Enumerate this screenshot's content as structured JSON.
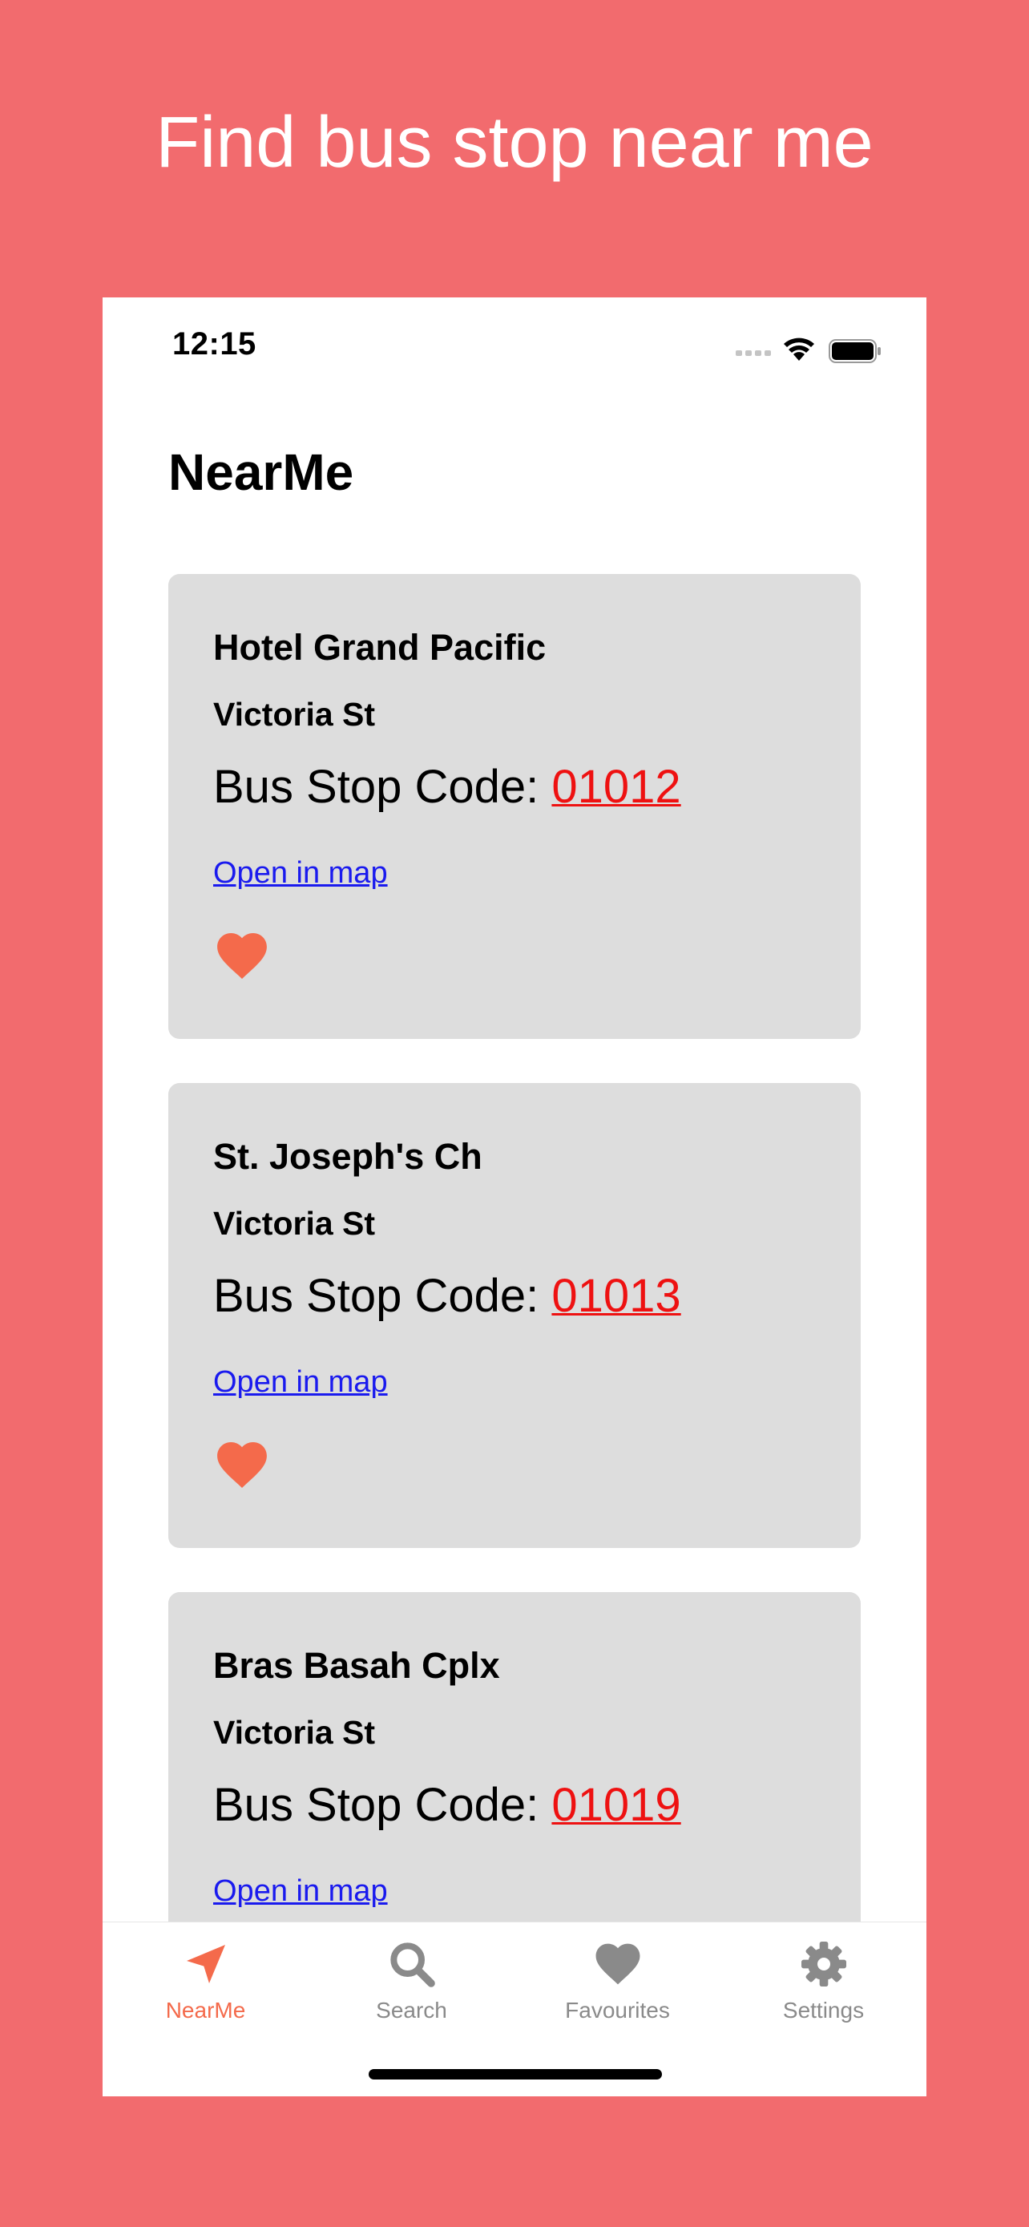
{
  "headline": "Find bus stop near me",
  "status_bar": {
    "time": "12:15"
  },
  "page_title": "NearMe",
  "colors": {
    "background": "#f26b6e",
    "accent": "#f46a4b",
    "code": "#ee1111",
    "link": "#1a1aee",
    "card": "#dddddd"
  },
  "bus_stops": [
    {
      "name": "Hotel Grand Pacific",
      "road": "Victoria St",
      "code_label": "Bus Stop Code:",
      "code": "01012",
      "map_link": "Open in map",
      "favourite": true
    },
    {
      "name": "St. Joseph's Ch",
      "road": "Victoria St",
      "code_label": "Bus Stop Code:",
      "code": "01013",
      "map_link": "Open in map",
      "favourite": true
    },
    {
      "name": "Bras Basah Cplx",
      "road": "Victoria St",
      "code_label": "Bus Stop Code:",
      "code": "01019",
      "map_link": "Open in map",
      "favourite": true
    }
  ],
  "tabs": [
    {
      "label": "NearMe",
      "icon": "location-arrow-icon",
      "active": true
    },
    {
      "label": "Search",
      "icon": "search-icon",
      "active": false
    },
    {
      "label": "Favourites",
      "icon": "heart-icon",
      "active": false
    },
    {
      "label": "Settings",
      "icon": "gear-icon",
      "active": false
    }
  ]
}
